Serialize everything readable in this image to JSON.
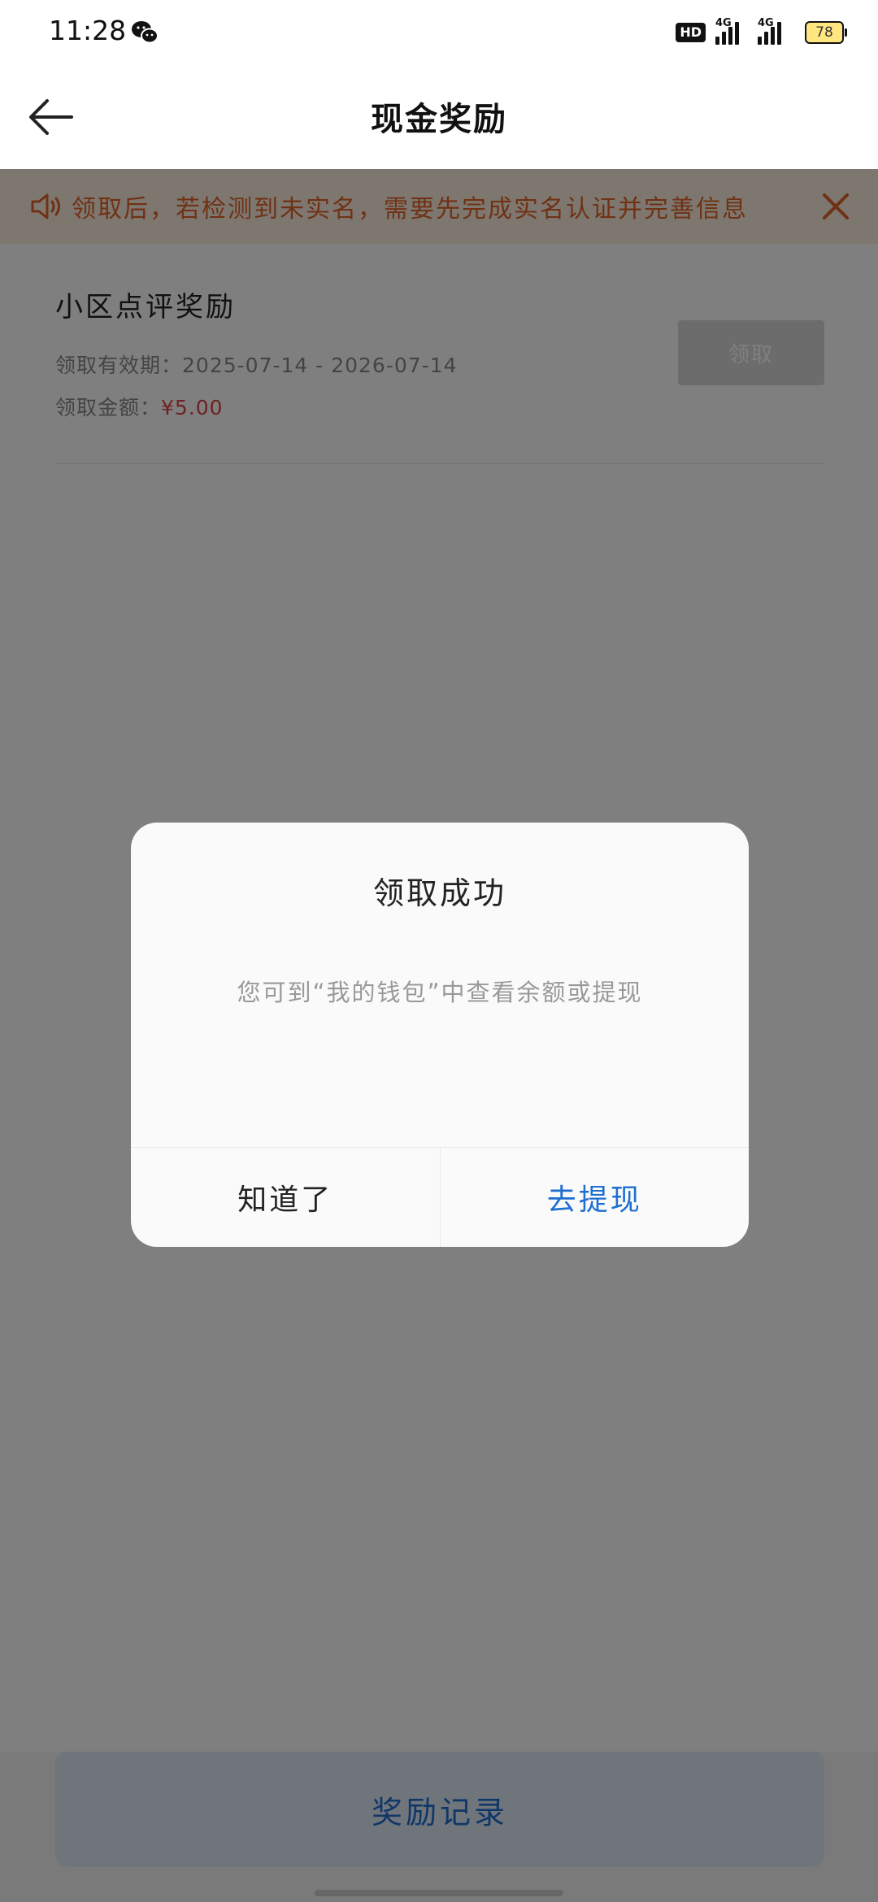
{
  "status_bar": {
    "time": "11:28",
    "network_1": "4G",
    "network_2": "4G",
    "hd_label": "HD",
    "battery": "78"
  },
  "header": {
    "title": "现金奖励"
  },
  "notice": {
    "text": "领取后，若检测到未实名，需要先完成实名认证并完善信息"
  },
  "reward": {
    "name": "小区点评奖励",
    "validity_label": "领取有效期：",
    "validity_value": "2025-07-14 - 2026-07-14",
    "amount_label": "领取金额：",
    "amount_value": "¥5.00",
    "claim_label": "领取"
  },
  "bottom": {
    "records_label": "奖励记录"
  },
  "dialog": {
    "title": "领取成功",
    "message": "您可到“我的钱包”中查看余额或提现",
    "ok_label": "知道了",
    "withdraw_label": "去提现"
  },
  "colors": {
    "accent_blue": "#1e6fd0",
    "notice_orange": "#e0632a",
    "amount_red": "#e04040"
  }
}
